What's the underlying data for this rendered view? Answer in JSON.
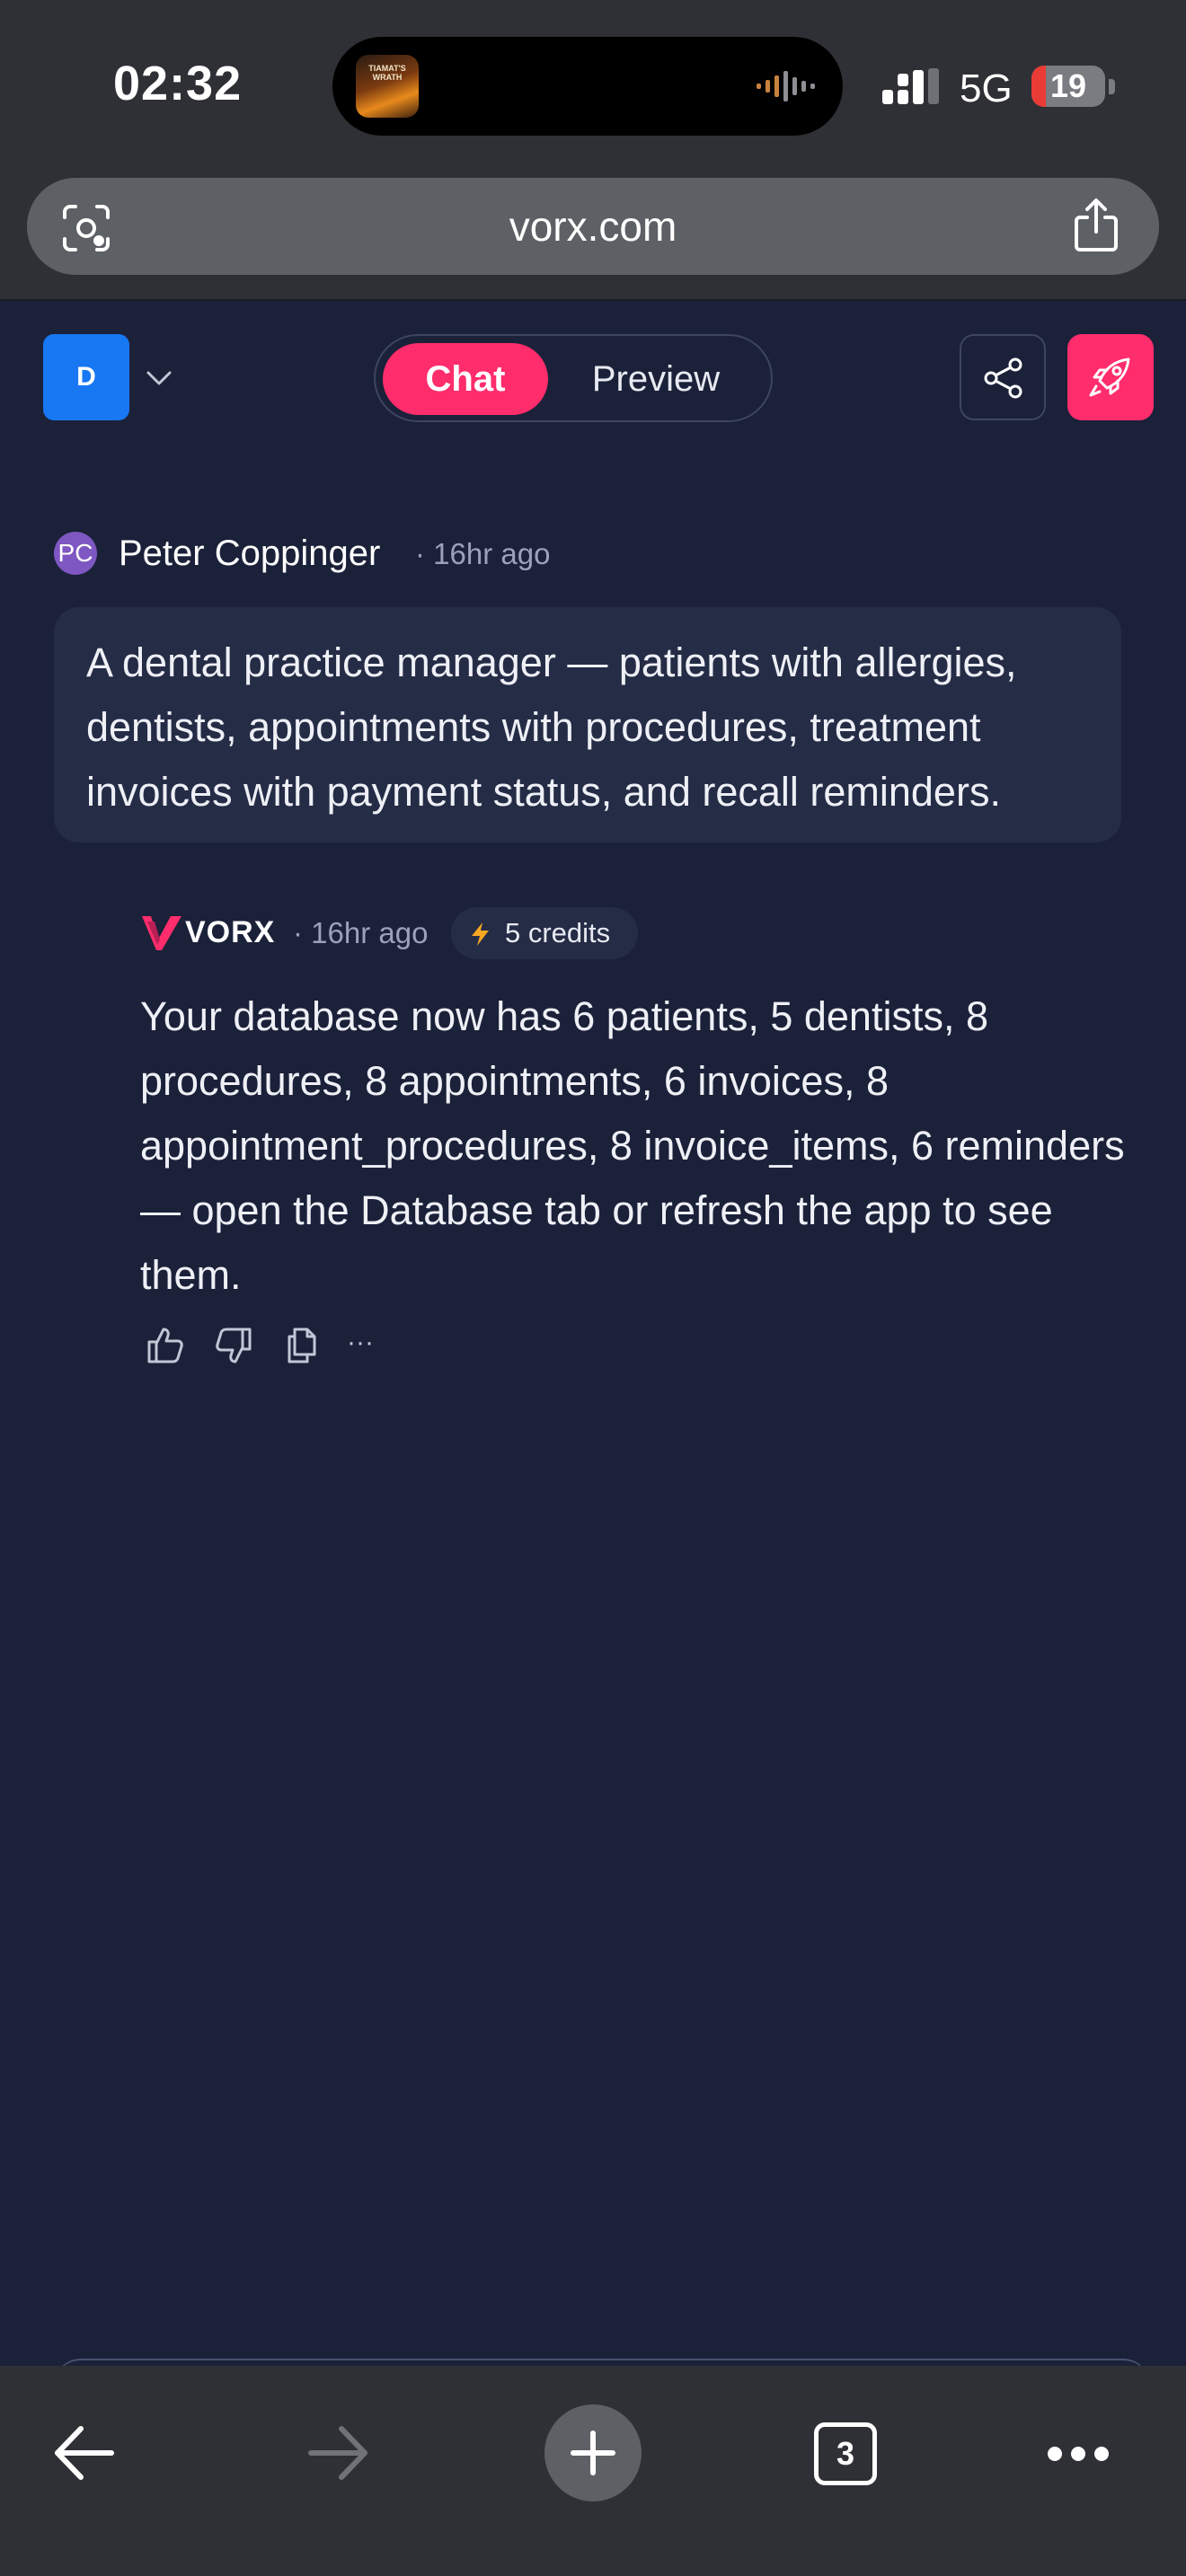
{
  "status_bar": {
    "time": "02:32",
    "now_playing_art_text": "TIAMAT'S WRATH",
    "network": "5G",
    "battery": "19",
    "battery_level": 0.19,
    "battery_color": "#ea3b35"
  },
  "browser": {
    "url": "vorx.com",
    "icons": {
      "scan": "camera-scan-icon",
      "share": "share-icon",
      "back": "back-arrow-icon",
      "forward": "forward-arrow-icon",
      "new_tab": "plus-icon",
      "more": "ellipsis-icon"
    },
    "tab_count": "3"
  },
  "header": {
    "workspace_initial": "D",
    "tabs": [
      {
        "label": "Chat",
        "active": true
      },
      {
        "label": "Preview",
        "active": false
      }
    ],
    "accent_color": "#ff2d6c"
  },
  "user_message": {
    "avatar_initials": "PC",
    "author": "Peter Coppinger",
    "time": "· 16hr ago",
    "text": "A dental practice manager — patients with allergies, dentists, appointments with procedures, treatment invoices with payment status, and recall reminders."
  },
  "assistant_message": {
    "brand": "VORX",
    "time": "· 16hr ago",
    "credits": "5 credits",
    "text": "Your database now has 6 patients, 5 dentists, 8 procedures, 8 appointments, 6 invoices, 8 appointment_procedures, 8 invoice_items, 6 reminders — open the Database tab or refresh the app to see them.",
    "more_label": "···"
  }
}
